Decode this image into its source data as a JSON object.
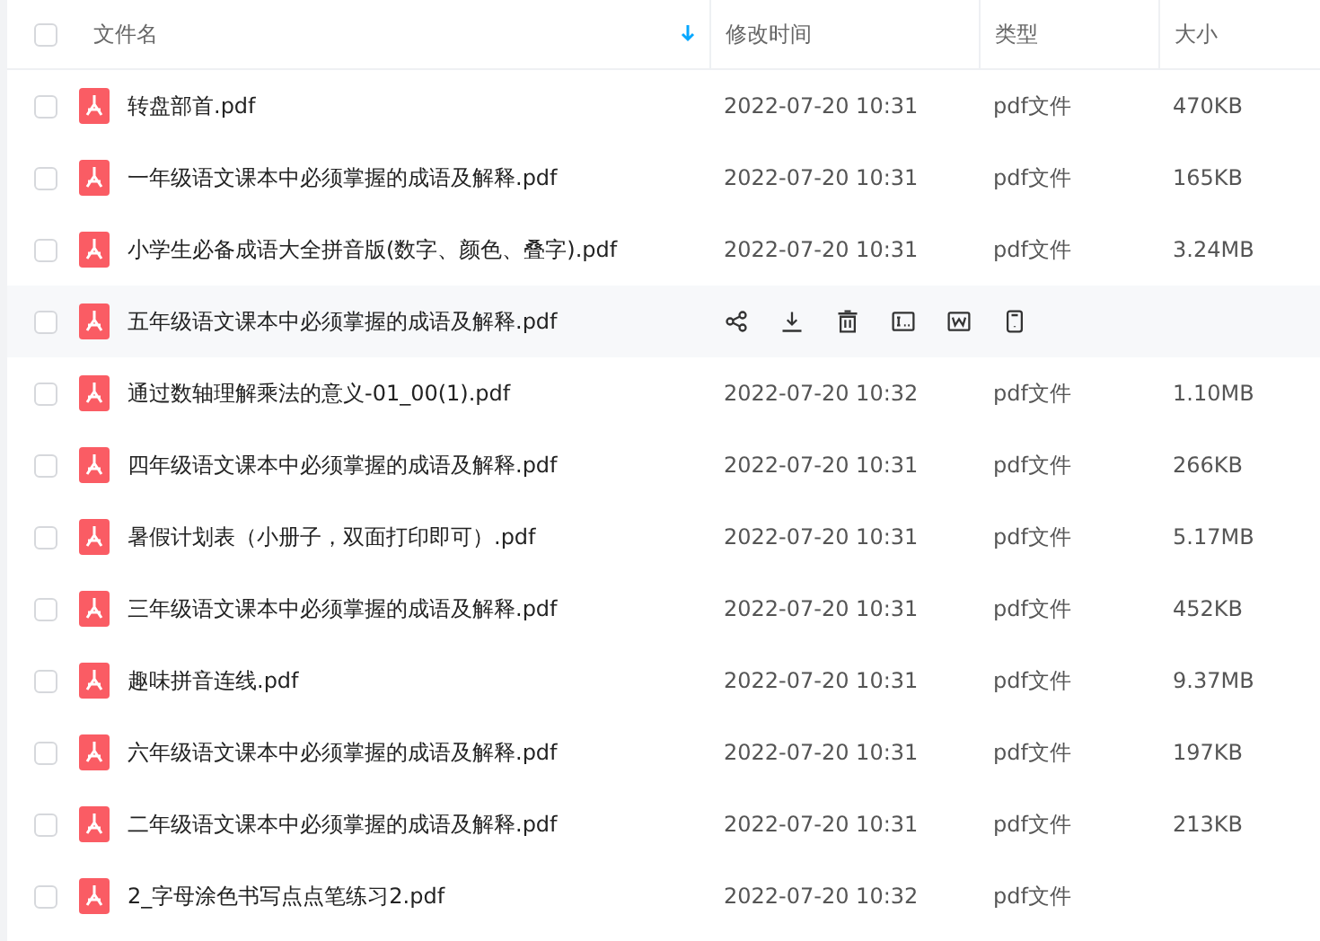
{
  "table": {
    "select_all": {
      "checked": false
    },
    "columns": [
      {
        "label": "文件名",
        "sorted": true
      },
      {
        "label": "修改时间",
        "sorted": false
      },
      {
        "label": "类型",
        "sorted": false
      },
      {
        "label": "大小",
        "sorted": false
      }
    ],
    "rows": [
      {
        "name": "转盘部首.pdf",
        "modified": "2022-07-20 10:31",
        "type": "pdf文件",
        "size": "470KB",
        "checked": false,
        "hovered": false
      },
      {
        "name": "一年级语文课本中必须掌握的成语及解释.pdf",
        "modified": "2022-07-20 10:31",
        "type": "pdf文件",
        "size": "165KB",
        "checked": false,
        "hovered": false
      },
      {
        "name": "小学生必备成语大全拼音版(数字、颜色、叠字).pdf",
        "modified": "2022-07-20 10:31",
        "type": "pdf文件",
        "size": "3.24MB",
        "checked": false,
        "hovered": false
      },
      {
        "name": "五年级语文课本中必须掌握的成语及解释.pdf",
        "checked": false,
        "hovered": true
      },
      {
        "name": "通过数轴理解乘法的意义-01_00(1).pdf",
        "modified": "2022-07-20 10:32",
        "type": "pdf文件",
        "size": "1.10MB",
        "checked": false,
        "hovered": false
      },
      {
        "name": "四年级语文课本中必须掌握的成语及解释.pdf",
        "modified": "2022-07-20 10:31",
        "type": "pdf文件",
        "size": "266KB",
        "checked": false,
        "hovered": false
      },
      {
        "name": "暑假计划表（小册子，双面打印即可）.pdf",
        "modified": "2022-07-20 10:31",
        "type": "pdf文件",
        "size": "5.17MB",
        "checked": false,
        "hovered": false
      },
      {
        "name": "三年级语文课本中必须掌握的成语及解释.pdf",
        "modified": "2022-07-20 10:31",
        "type": "pdf文件",
        "size": "452KB",
        "checked": false,
        "hovered": false
      },
      {
        "name": "趣味拼音连线.pdf",
        "modified": "2022-07-20 10:31",
        "type": "pdf文件",
        "size": "9.37MB",
        "checked": false,
        "hovered": false
      },
      {
        "name": "六年级语文课本中必须掌握的成语及解释.pdf",
        "modified": "2022-07-20 10:31",
        "type": "pdf文件",
        "size": "197KB",
        "checked": false,
        "hovered": false
      },
      {
        "name": "二年级语文课本中必须掌握的成语及解释.pdf",
        "modified": "2022-07-20 10:31",
        "type": "pdf文件",
        "size": "213KB",
        "checked": false,
        "hovered": false
      },
      {
        "name": "2_字母涂色书写点点笔练习2.pdf",
        "modified": "2022-07-20 10:32",
        "type": "pdf文件",
        "checked": false,
        "hovered": false
      }
    ]
  }
}
